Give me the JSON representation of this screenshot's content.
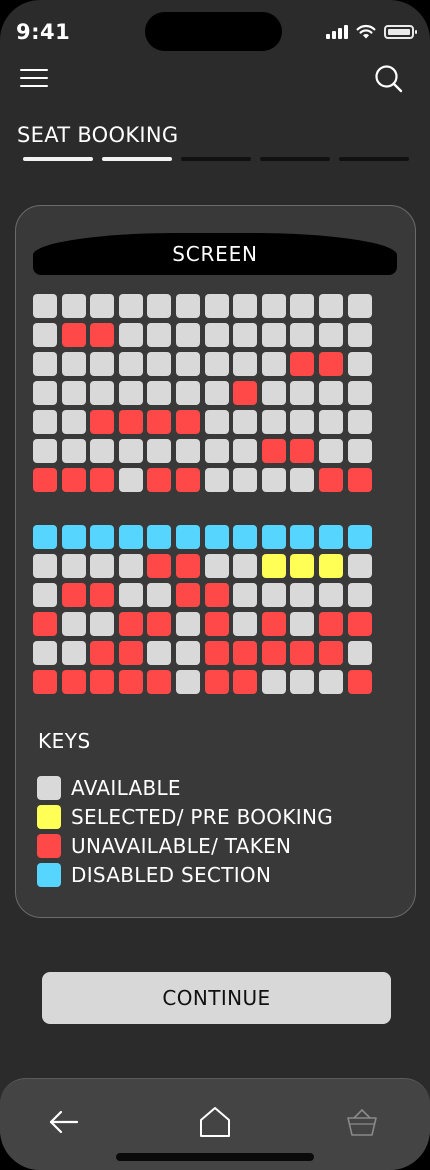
{
  "status_bar": {
    "time": "9:41"
  },
  "header": {
    "page_title": "SEAT BOOKING",
    "progress_steps": [
      true,
      true,
      false,
      false,
      false
    ]
  },
  "seating": {
    "screen_label": "SCREEN",
    "colors": {
      "A": "#d9d9d9",
      "S": "#ffff55",
      "T": "#ff4848",
      "D": "#55d5ff"
    },
    "upper_block": [
      "AAAAAAAAAAAA",
      "ATTAAAAAAAAA",
      "AAAAAAAAATTA",
      "AAAAAAATAAAA",
      "AATTTTAAAAAA",
      "AAAAAAAATTAA",
      "TTTATTAAAATT"
    ],
    "lower_block": [
      "DDDDDDDDDDDD",
      "AAAATTAASSSA",
      "ATTAATTAAAAA",
      "TAATTATATATT",
      "AATTAATTTTTA",
      "TTTTTATTAAAT"
    ]
  },
  "keys": {
    "title": "KEYS",
    "items": [
      {
        "code": "A",
        "label": "AVAILABLE"
      },
      {
        "code": "S",
        "label": "SELECTED/ PRE BOOKING"
      },
      {
        "code": "T",
        "label": "UNAVAILABLE/ TAKEN"
      },
      {
        "code": "D",
        "label": "DISABLED SECTION"
      }
    ]
  },
  "actions": {
    "continue_label": "CONTINUE"
  },
  "bottom_nav": {
    "items": [
      "back-arrow-icon",
      "home-icon",
      "basket-icon"
    ]
  }
}
